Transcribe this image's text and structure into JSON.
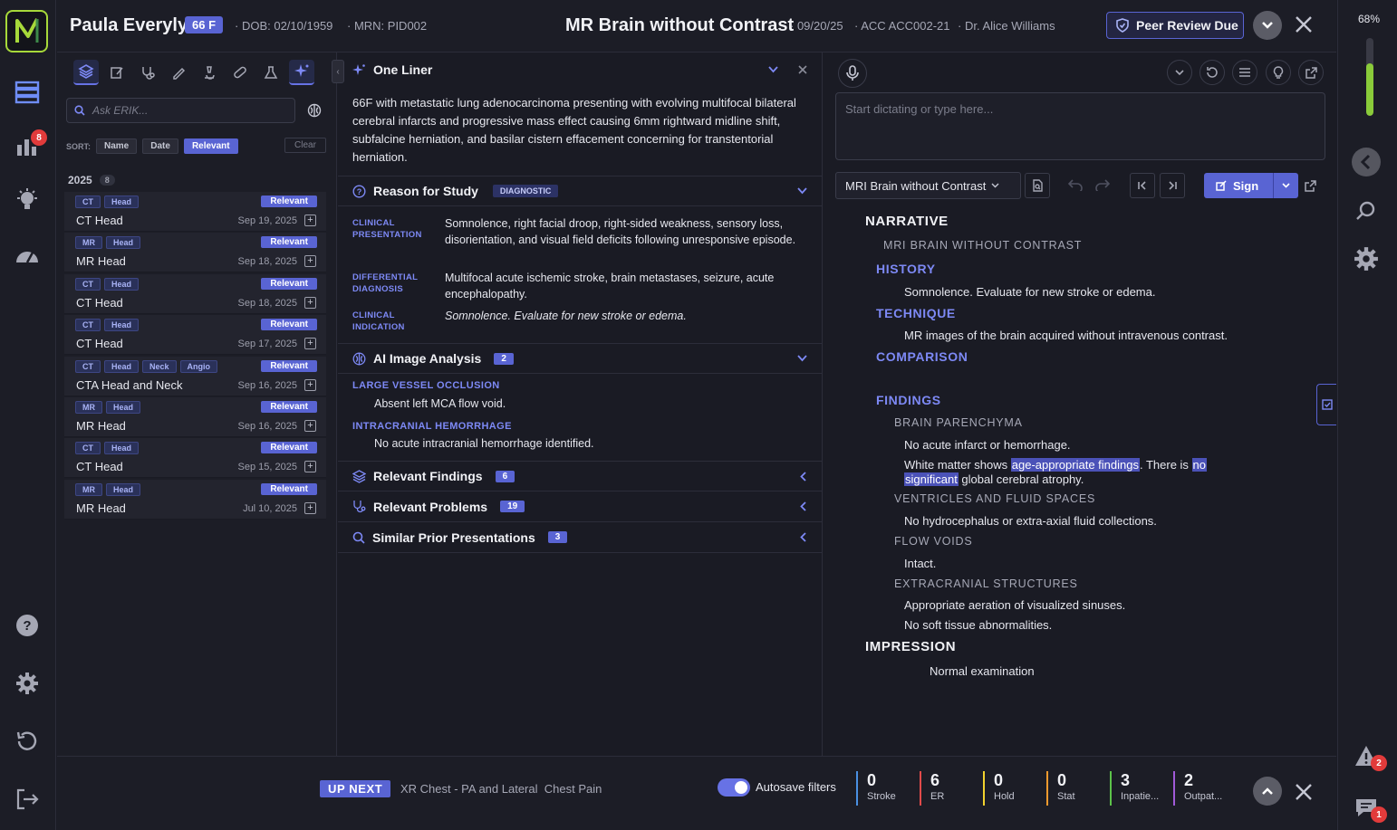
{
  "rail": {
    "notification_count": "8",
    "icons": [
      "worklist-icon",
      "analytics-icon",
      "insights-icon",
      "dashboard-icon",
      "help-icon",
      "settings-icon",
      "history-icon",
      "logout-icon"
    ]
  },
  "header": {
    "patient_name": "Paula Everyly",
    "age_sex": "66 F",
    "dob": "· DOB: 02/10/1959",
    "mrn": "· MRN: PID002",
    "study_title": "MR Brain without Contrast",
    "study_date": "· 09/20/25",
    "accession": "· ACC ACC002-21",
    "physician": "· Dr. Alice Williams",
    "peer_review_label": "Peer Review Due"
  },
  "left_panel": {
    "ask_placeholder": "Ask ERIK...",
    "sort_label": "SORT:",
    "sort_options": [
      "Name",
      "Date",
      "Relevant"
    ],
    "sort_selected": "Relevant",
    "clear_label": "Clear",
    "year": "2025",
    "year_count": "8",
    "relevant_label": "Relevant",
    "studies": [
      {
        "tags": [
          "CT",
          "Head"
        ],
        "name": "CT Head",
        "date": "Sep 19, 2025"
      },
      {
        "tags": [
          "MR",
          "Head"
        ],
        "name": "MR Head",
        "date": "Sep 18, 2025"
      },
      {
        "tags": [
          "CT",
          "Head"
        ],
        "name": "CT Head",
        "date": "Sep 18, 2025"
      },
      {
        "tags": [
          "CT",
          "Head"
        ],
        "name": "CT Head",
        "date": "Sep 17, 2025"
      },
      {
        "tags": [
          "CT",
          "Head",
          "Neck",
          "Angio"
        ],
        "name": "CTA Head and Neck",
        "date": "Sep 16, 2025"
      },
      {
        "tags": [
          "MR",
          "Head"
        ],
        "name": "MR Head",
        "date": "Sep 16, 2025"
      },
      {
        "tags": [
          "CT",
          "Head"
        ],
        "name": "CT Head",
        "date": "Sep 15, 2025"
      },
      {
        "tags": [
          "MR",
          "Head"
        ],
        "name": "MR Head",
        "date": "Jul 10, 2025"
      }
    ]
  },
  "middle_panel": {
    "one_liner_title": "One Liner",
    "one_liner_text": "66F with metastatic lung adenocarcinoma presenting with evolving multifocal bilateral cerebral infarcts and progressive mass effect causing 6mm rightward midline shift, subfalcine herniation, and basilar cistern effacement concerning for transtentorial herniation.",
    "reason_title": "Reason for Study",
    "reason_badge": "DIAGNOSTIC",
    "clinical_presentation_label": "CLINICAL PRESENTATION",
    "clinical_presentation": "Somnolence, right facial droop, right-sided weakness, sensory loss, disorientation, and visual field deficits following unresponsive episode.",
    "differential_label": "DIFFERENTIAL DIAGNOSIS",
    "differential": "Multifocal acute ischemic stroke, brain metastases, seizure, acute encephalopathy.",
    "indication_label": "CLINICAL INDICATION",
    "indication": "Somnolence. Evaluate for new stroke or edema.",
    "ai_title": "AI Image Analysis",
    "ai_count": "2",
    "lvo_label": "LARGE VESSEL OCCLUSION",
    "lvo_text": "Absent left MCA flow void.",
    "ich_label": "INTRACRANIAL HEMORRHAGE",
    "ich_text": "No acute intracranial hemorrhage identified.",
    "relevant_findings_title": "Relevant Findings",
    "relevant_findings_count": "6",
    "relevant_problems_title": "Relevant Problems",
    "relevant_problems_count": "19",
    "similar_priors_title": "Similar Prior Presentations",
    "similar_priors_count": "3"
  },
  "right_panel": {
    "dictation_placeholder": "Start dictating or type here...",
    "template": "MRI Brain without Contrast",
    "sign_label": "Sign",
    "report": {
      "narrative": "NARRATIVE",
      "exam_title": "MRI BRAIN WITHOUT CONTRAST",
      "history_h": "HISTORY",
      "history": "Somnolence. Evaluate for new stroke or edema.",
      "technique_h": "TECHNIQUE",
      "technique": "MR images of the brain acquired without intravenous contrast.",
      "comparison_h": "COMPARISON",
      "findings_h": "FINDINGS",
      "parenchyma_h": "BRAIN PARENCHYMA",
      "parenchyma_1": "No acute infarct or hemorrhage.",
      "wm_a": "White matter shows ",
      "wm_hl1": "age-appropriate findings",
      "wm_b": ". There is ",
      "wm_hl2": "no",
      "wm_hl3": "significant",
      "wm_c": " global cerebral atrophy.",
      "ventricles_h": "VENTRICLES AND FLUID SPACES",
      "ventricles": "No hydrocephalus or extra-axial fluid collections.",
      "flow_h": "FLOW VOIDS",
      "flow": "Intact.",
      "extracranial_h": "EXTRACRANIAL STRUCTURES",
      "extracranial_1": "Appropriate aeration of visualized sinuses.",
      "extracranial_2": "No soft tissue abnormalities.",
      "impression_h": "IMPRESSION",
      "impression": "Normal examination"
    }
  },
  "far_right": {
    "percent": "68%",
    "level": 0.68,
    "alerts_count": "2",
    "messages_count": "1"
  },
  "bottom_bar": {
    "up_next_label": "UP NEXT",
    "up_next_study": "XR Chest - PA and Lateral",
    "up_next_reason": "Chest Pain",
    "autosave_label": "Autosave filters",
    "autosave_on": true,
    "stats": [
      {
        "count": "0",
        "label": "Stroke",
        "color": "#4a90e2"
      },
      {
        "count": "6",
        "label": "ER",
        "color": "#e24a4a"
      },
      {
        "count": "0",
        "label": "Hold",
        "color": "#f2d22e"
      },
      {
        "count": "0",
        "label": "Stat",
        "color": "#f29a2e"
      },
      {
        "count": "3",
        "label": "Inpatie...",
        "color": "#5cc24a"
      },
      {
        "count": "2",
        "label": "Outpat...",
        "color": "#a15ad8"
      }
    ]
  }
}
